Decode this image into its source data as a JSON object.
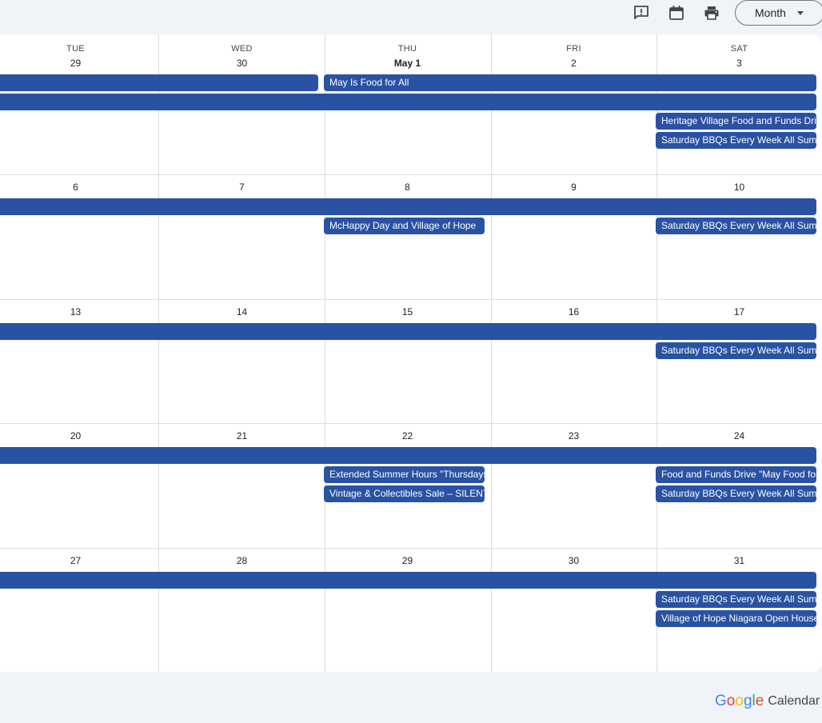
{
  "toolbar": {
    "icons": [
      "feedback-icon",
      "calendar-icon",
      "print-icon"
    ],
    "view_label": "Month"
  },
  "weekdays": [
    "TUE",
    "WED",
    "THU",
    "FRI",
    "SAT"
  ],
  "weeks": [
    {
      "days": [
        "29",
        "30",
        "May 1",
        "2",
        "3"
      ]
    },
    {
      "days": [
        "6",
        "7",
        "8",
        "9",
        "10"
      ]
    },
    {
      "days": [
        "13",
        "14",
        "15",
        "16",
        "17"
      ]
    },
    {
      "days": [
        "20",
        "21",
        "22",
        "23",
        "24"
      ]
    },
    {
      "days": [
        "27",
        "28",
        "29",
        "30",
        "31"
      ]
    }
  ],
  "events": {
    "w1_thu_span": "May Is Food for All",
    "w1_sat_1": "Heritage Village Food and Funds Drive",
    "w1_sat_2": "Saturday BBQs Every Week All Summer",
    "w2_thu": "McHappy Day and Village of Hope",
    "w2_sat": "Saturday BBQs Every Week All Summer",
    "w3_sat": "Saturday BBQs Every Week All Summer",
    "w4_thu_1": "Extended Summer Hours \"Thursdays\"",
    "w4_thu_2": "Vintage & Collectibles Sale – SILENT",
    "w4_sat_1": "Food and Funds Drive \"May Food for All\"",
    "w4_sat_2": "Saturday BBQs Every Week All Summer",
    "w5_sat_1": "Saturday BBQs Every Week All Summer",
    "w5_sat_2": "Village of Hope Niagara Open House"
  },
  "branding": {
    "google_letters": [
      "G",
      "o",
      "o",
      "g",
      "l",
      "e"
    ],
    "google_colors": [
      "#4285F4",
      "#EA4335",
      "#FBBC05",
      "#4285F4",
      "#34A853",
      "#EA4335"
    ],
    "product": "Calendar"
  },
  "colors": {
    "event": "#2952a3",
    "page_bg": "#f0f4f9"
  }
}
